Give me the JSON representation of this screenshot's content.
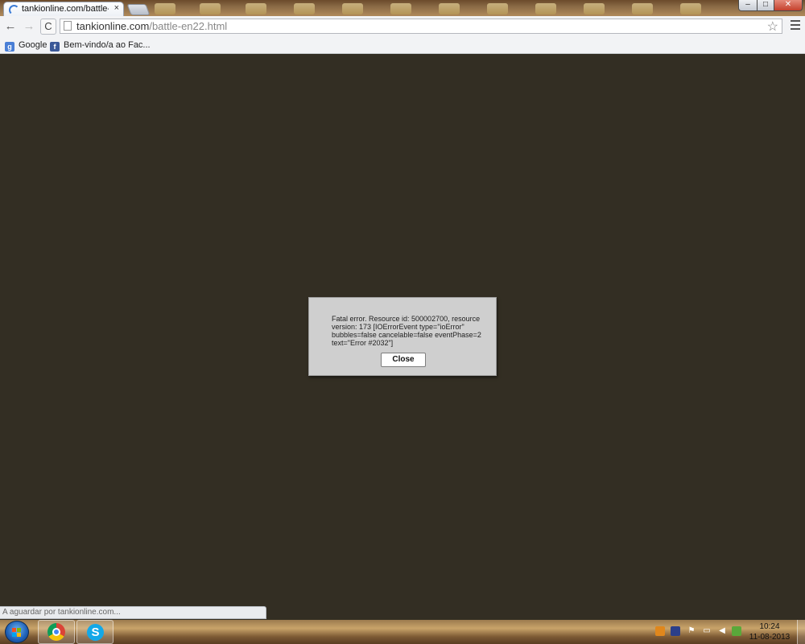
{
  "browser": {
    "tab_title": "tankionline.com/battle-en",
    "tab_close": "×",
    "url_host": "tankionline.com",
    "url_path": "/battle-en22.html",
    "back_glyph": "←",
    "forward_glyph": "→",
    "reload_glyph": "C",
    "star_glyph": "☆",
    "window_buttons": {
      "minimize": "–",
      "maximize": "□",
      "close": "✕"
    }
  },
  "bookmarks": [
    {
      "label": "Google",
      "icon": "google-icon",
      "color": "#4a7fd6"
    },
    {
      "label": "Bem-vindo/a ao Fac...",
      "icon": "facebook-icon",
      "color": "#3b5998"
    }
  ],
  "dialog": {
    "message": "Fatal error. Resource id: 500002700, resource version: 173 [IOErrorEvent type=\"ioError\" bubbles=false cancelable=false eventPhase=2 text=\"Error #2032\"]",
    "close_label": "Close"
  },
  "status": {
    "text": "A aguardar por tankionline.com..."
  },
  "taskbar": {
    "apps": [
      {
        "name": "chrome-icon"
      },
      {
        "name": "skype-icon",
        "glyph": "S"
      }
    ],
    "clock_time": "10:24",
    "clock_date": "11-08-2013"
  },
  "colors": {
    "content_bg": "#332e23",
    "dialog_bg": "#cfcfcf"
  }
}
